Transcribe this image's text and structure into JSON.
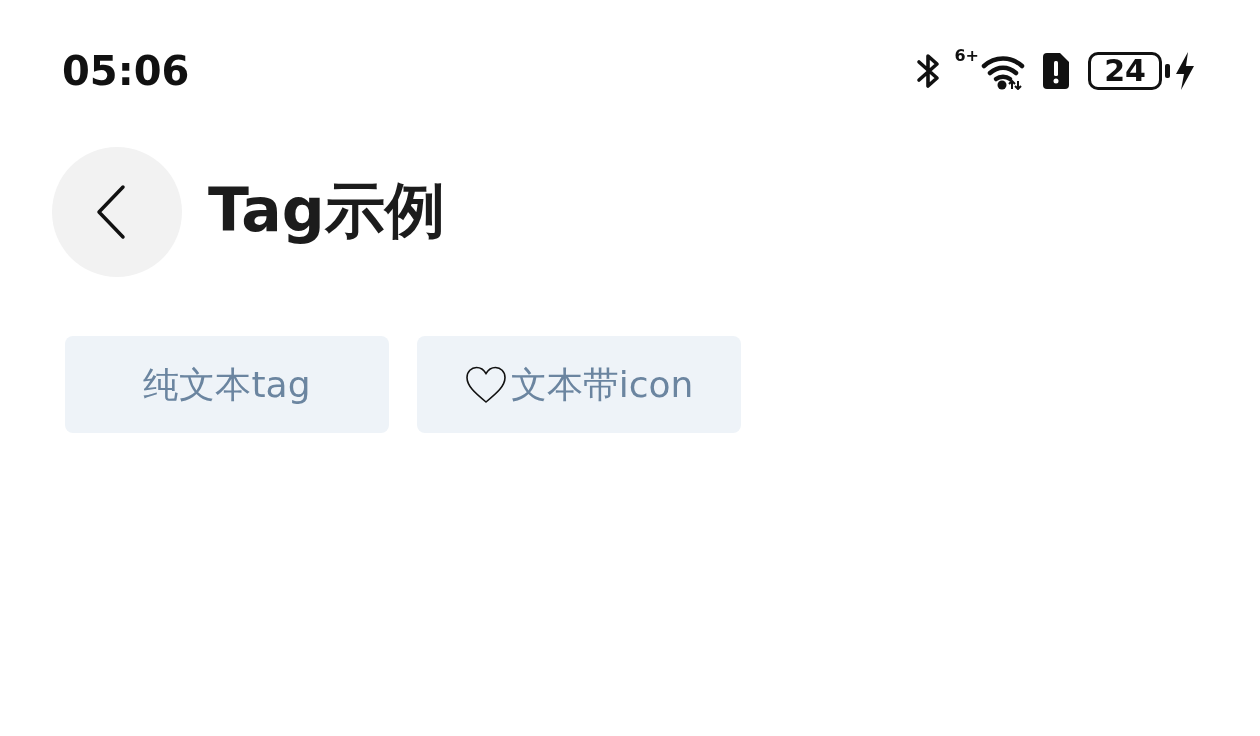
{
  "status_bar": {
    "time": "05:06",
    "wifi_label": "6+",
    "battery": "24",
    "charging": true
  },
  "header": {
    "title": "Tag示例"
  },
  "tags": [
    {
      "kind": "text",
      "label": "纯文本tag"
    },
    {
      "kind": "icon",
      "label": "文本带icon"
    }
  ]
}
